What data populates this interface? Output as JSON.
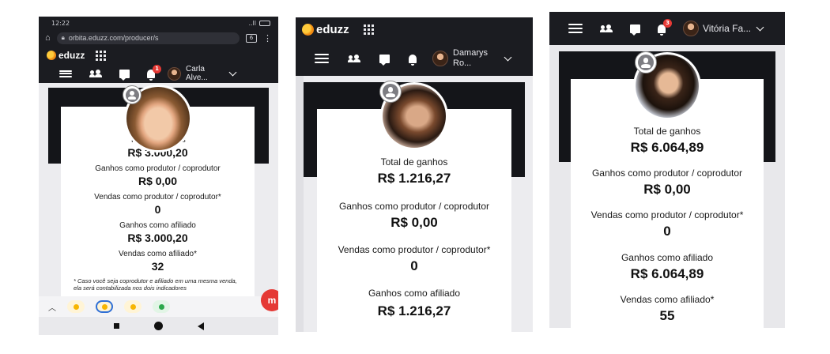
{
  "phone1": {
    "status": {
      "time": "12:22",
      "right": "..ll"
    },
    "browser": {
      "url": "orbita.eduzz.com/producer/s",
      "tabs": "6"
    },
    "brand": "eduzz",
    "nav": {
      "badge": "1",
      "user": [
        "Carla",
        "Alve..."
      ]
    },
    "stats": [
      {
        "label": "Total de ganhos",
        "value": "R$ 3.000,20"
      },
      {
        "label": "Ganhos como produtor / coprodutor",
        "value": "R$ 0,00"
      },
      {
        "label": "Vendas como produtor / coprodutor*",
        "value": "0"
      },
      {
        "label": "Ganhos como afiliado",
        "value": "R$ 3.000,20"
      },
      {
        "label": "Vendas como afiliado*",
        "value": "32"
      }
    ],
    "note": "* Caso você seja coprodutor e afiliado em uma mesma venda, ela será contabilizada nos dois indicadores"
  },
  "phone2": {
    "brand": "eduzz",
    "nav": {
      "user": [
        "Damarys",
        "Ro..."
      ]
    },
    "stats": [
      {
        "label": "Total de ganhos",
        "value": "R$ 1.216,27"
      },
      {
        "label": "Ganhos como produtor / coprodutor",
        "value": "R$ 0,00"
      },
      {
        "label": "Vendas como produtor / coprodutor*",
        "value": "0"
      },
      {
        "label": "Ganhos como afiliado",
        "value": "R$ 1.216,27"
      }
    ]
  },
  "phone3": {
    "nav": {
      "badge": "3",
      "user": "Vitória Fa..."
    },
    "stats": [
      {
        "label": "Total de ganhos",
        "value": "R$ 6.064,89"
      },
      {
        "label": "Ganhos como produtor / coprodutor",
        "value": "R$ 0,00"
      },
      {
        "label": "Vendas como produtor / coprodutor*",
        "value": "0"
      },
      {
        "label": "Ganhos como afiliado",
        "value": "R$ 6.064,89"
      },
      {
        "label": "Vendas como afiliado*",
        "value": "55"
      }
    ]
  },
  "colors": {
    "navbar": "#1b1c21",
    "accent": "#f7a21b",
    "badge": "#e53935"
  }
}
